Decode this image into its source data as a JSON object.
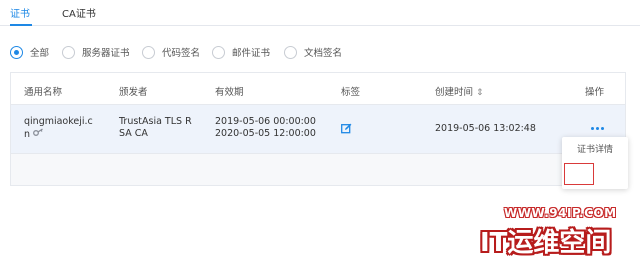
{
  "tabs": [
    {
      "label": "证书",
      "active": true
    },
    {
      "label": "CA证书",
      "active": false
    }
  ],
  "filter": {
    "selected": "全部",
    "options": [
      "全部",
      "服务器证书",
      "代码签名",
      "邮件证书",
      "文档签名"
    ]
  },
  "table": {
    "columns": [
      "通用名称",
      "颁发者",
      "有效期",
      "标签",
      "创建时间",
      "操作"
    ],
    "sort_icon": "sort-updown-icon",
    "rows": [
      {
        "common_name_line1": "qingmiaokeji.c",
        "common_name_line2": "n",
        "issuer_line1": "TrustAsia TLS R",
        "issuer_line2": "SA CA",
        "valid_from": "2019-05-06 00:00:00",
        "valid_to": "2020-05-05 12:00:00",
        "created": "2019-05-06 13:02:48"
      }
    ]
  },
  "action_menu": {
    "items": [
      "证书详情"
    ]
  },
  "watermark": {
    "url": "WWW.94IP.COM",
    "brand": "IT运维空间"
  },
  "colors": {
    "accent": "#1e88e5",
    "row_highlight": "#eef3fb",
    "watermark_red": "#c62828"
  }
}
